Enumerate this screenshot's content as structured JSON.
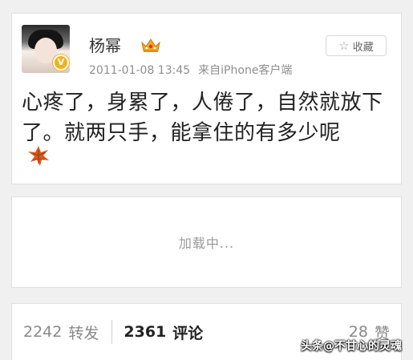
{
  "post": {
    "username": "杨幂",
    "verified_badge": "V",
    "crown_icon": "crown-icon",
    "timestamp": "2011-01-08 13:45",
    "source": "来自iPhone客户端",
    "favorite_label": "收藏",
    "favorite_icon": "star-outline-icon",
    "text": "心疼了，身累了，人倦了，自然就放下了。就两只手，能拿住的有多少呢",
    "emoji": "falling-leaf-emoji"
  },
  "loading": {
    "text": "加载中..."
  },
  "actions": {
    "repost_count": "2242",
    "repost_label": "转发",
    "comment_count": "2361",
    "comment_label": "评论",
    "like_count": "28",
    "like_label": "赞"
  },
  "watermark": {
    "text": "头条@不甘心的灵魂"
  },
  "colors": {
    "background": "#f0f0f0",
    "card": "#ffffff",
    "text_primary": "#222222",
    "text_secondary": "#8f8f8f",
    "badge": "#f2b11b"
  }
}
